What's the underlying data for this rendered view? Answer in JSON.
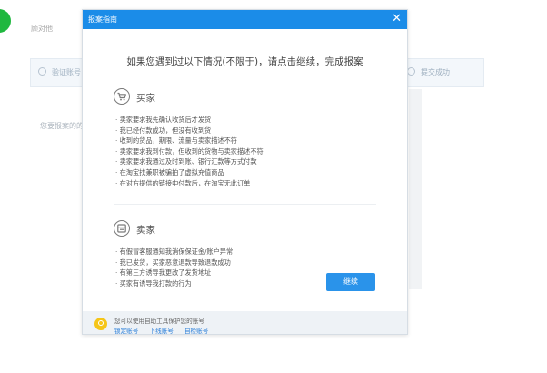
{
  "background": {
    "side_label": "顾对他",
    "step_1": "验证账号",
    "step_last": "提交成功",
    "body_text": "您要报案的的"
  },
  "modal": {
    "title": "报案指南",
    "close_glyph": "✕",
    "headline": "如果您遇到过以下情况(不限于)，请点击继续，完成报案",
    "buyer": {
      "title": "买家",
      "icon": "shopping-cart-icon",
      "items": [
        "· 卖家要求我先确认收货后才发货",
        "· 我已经付款成功，但没有收到货",
        "· 收到的货品，期限、流量与卖家描述不符",
        "· 卖家要求我到付款，但收到的货物与卖家描述不符",
        "· 卖家要求我通过及时到账、银行汇款等方式付款",
        "· 在淘宝找兼职被骗拍了虚拟充值商品",
        "· 在对方提供的链接中付款后，在淘宝无此订单"
      ]
    },
    "seller": {
      "title": "卖家",
      "icon": "store-icon",
      "items": [
        "· 有假冒客服通知我消保保证金/账户异常",
        "· 我已发货，买家恶意退款导致退款成功",
        "· 有第三方诱导我更改了发货地址",
        "· 买家有诱导我打款的行为"
      ]
    },
    "continue_label": "继续",
    "footer": {
      "tip": "您可以使用自助工具保护您的账号",
      "links": [
        "锁定账号",
        "下线账号",
        "自检账号"
      ]
    }
  },
  "colors": {
    "header_blue": "#1b8ce8",
    "button_blue": "#2a93ea",
    "link_blue": "#2a7ed8",
    "tip_yellow": "#f5c518",
    "dot_green": "#1fb83f"
  }
}
